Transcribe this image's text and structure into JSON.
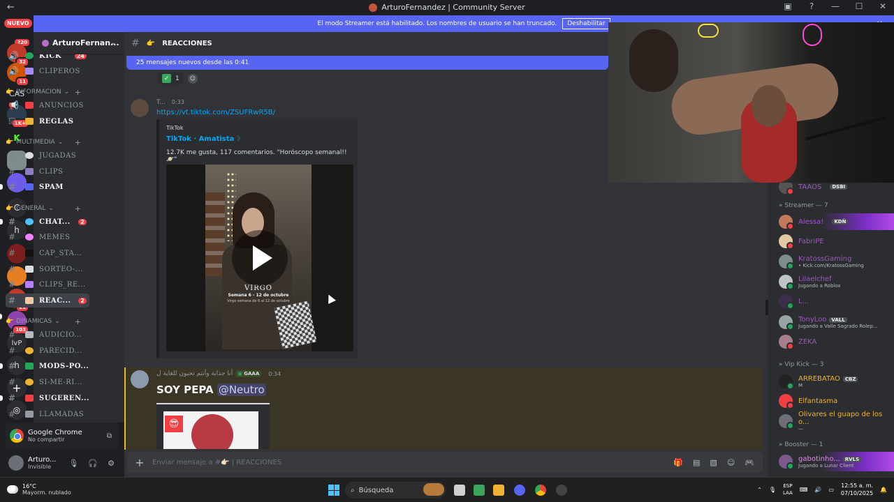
{
  "window": {
    "title": "ArturoFernandez | Community Server"
  },
  "streamer_bar": {
    "text": "El modo Streamer está habilitado. Los nombres de usuario se han truncado.",
    "button": "Deshabilitar"
  },
  "rail": {
    "nuevo": "NUEVO",
    "nuevo_count": "220",
    "servers": [
      {
        "label": "",
        "badge": "32"
      },
      {
        "label": "",
        "badge": "11"
      },
      {
        "label": "CAS",
        "badge": ""
      },
      {
        "label": "",
        "badge": "1K+"
      },
      {
        "label": "K",
        "badge": ""
      },
      {
        "label": "",
        "badge": ""
      },
      {
        "label": "",
        "badge": ""
      },
      {
        "label": "C",
        "badge": ""
      },
      {
        "label": "h",
        "badge": ""
      },
      {
        "label": "",
        "badge": ""
      },
      {
        "label": "",
        "badge": ""
      },
      {
        "label": "",
        "badge": "21"
      },
      {
        "label": "",
        "badge": "103"
      },
      {
        "label": "lvP",
        "badge": ""
      },
      {
        "label": "h",
        "badge": ""
      }
    ]
  },
  "server": {
    "name": "ArturoFernan...",
    "channels_top": [
      {
        "name": "KICK",
        "badge": "24"
      },
      {
        "name": "CLIPEROS",
        "badge": ""
      }
    ],
    "categories": [
      {
        "name": "INFORMACION",
        "channels": [
          {
            "name": "ANUNCIOS",
            "badge": ""
          },
          {
            "name": "REGLAS",
            "badge": ""
          }
        ]
      },
      {
        "name": "MULTIMEDIA",
        "channels": [
          {
            "name": "JUGADAS",
            "badge": ""
          },
          {
            "name": "CLIPS",
            "badge": ""
          },
          {
            "name": "SPAM",
            "badge": ""
          }
        ]
      },
      {
        "name": "GENERAL",
        "channels": [
          {
            "name": "CHAT...",
            "badge": "2"
          },
          {
            "name": "MEMES",
            "badge": ""
          },
          {
            "name": "CAP_STA...",
            "badge": ""
          },
          {
            "name": "SORTEO-...",
            "badge": ""
          },
          {
            "name": "CLIPS_RE...",
            "badge": ""
          },
          {
            "name": "REAC...",
            "badge": "2"
          }
        ]
      },
      {
        "name": "DINAMICAS",
        "channels": [
          {
            "name": "AUDICIO...",
            "badge": ""
          },
          {
            "name": "PARECID...",
            "badge": ""
          },
          {
            "name": "MODS-PO...",
            "badge": ""
          },
          {
            "name": "SI-ME-RI...",
            "badge": ""
          },
          {
            "name": "SUGEREN...",
            "badge": ""
          },
          {
            "name": "LLAMADAS",
            "badge": ""
          }
        ]
      }
    ]
  },
  "notification": {
    "app": "Google Chrome",
    "sub": "No compartir"
  },
  "user": {
    "name": "Arturo...",
    "status": "Invisible"
  },
  "channel": {
    "name": "REACCIONES"
  },
  "new_messages_bar": "25 mensajes nuevos desde las 0:41",
  "reaction": {
    "count": "1"
  },
  "message1": {
    "author": "T...",
    "time": "0:33",
    "link": "https://vt.tiktok.com/ZSUFRwR5B/",
    "embed": {
      "provider": "TikTok",
      "title": "TikTok · Amatista☽",
      "description": "12.7K me gusta, 117 comentarios. \"Horóscopo semanal!! 🪐\"",
      "video_title": "VIRGO",
      "video_sub": "Semana 6 - 12 de octubre",
      "video_sub2": "Virgo semana de 6 al 12 de octubre"
    }
  },
  "message2": {
    "author": "أنا جذابة وأنتم تحبون للغاية ل",
    "tag": "GAAA",
    "time": "0:34",
    "text": "SOY PEPA",
    "mention": "@Neutro"
  },
  "composer": {
    "placeholder": "Enviar mensaje a #👉🏻 | REACCIONES"
  },
  "members": {
    "top_partial": {
      "name": "TAAOS",
      "chip": "DSBI"
    },
    "sections": [
      {
        "title": "» Streamer — 7",
        "items": [
          {
            "name": "Alessa!",
            "chip": "KDÑ",
            "sub": "",
            "color": "#b04ae8"
          },
          {
            "name": "FabriPE",
            "chip": "",
            "sub": "",
            "color": "#9b59b6"
          },
          {
            "name": "KratossGaming",
            "chip": "",
            "sub": "• Kick.com/KratossGaming",
            "color": "#9b59b6"
          },
          {
            "name": "Lilaelchef",
            "chip": "",
            "sub": "Jugando a Roblox",
            "color": "#9b59b6"
          },
          {
            "name": "L...",
            "chip": "",
            "sub": "",
            "color": "#9b59b6"
          },
          {
            "name": "TonyLoo",
            "chip": "VALL",
            "sub": "Jugando a Valle Sagrado Rolep...",
            "color": "#9b59b6"
          },
          {
            "name": "ZEKA",
            "chip": "",
            "sub": "",
            "color": "#9b59b6"
          }
        ]
      },
      {
        "title": "» Vip Kick — 3",
        "items": [
          {
            "name": "ARREBATAO",
            "chip": "CBZ",
            "sub": "M",
            "color": "#f0b232"
          },
          {
            "name": "Elfantasma",
            "chip": "",
            "sub": "",
            "color": "#f0b232"
          },
          {
            "name": "Olivares el guapo de los o...",
            "chip": "",
            "sub": "—",
            "color": "#f0b232"
          }
        ]
      },
      {
        "title": "» Booster — 1",
        "items": [
          {
            "name": "gabotinho...",
            "chip": "RVLS",
            "sub": "Jugando a Lunar Client",
            "color": "#e08ee8"
          }
        ]
      }
    ]
  },
  "taskbar": {
    "weather_temp": "16°C",
    "weather_desc": "Mayorm. nublado",
    "search": "Búsqueda",
    "lang1": "ESP",
    "lang2": "LAA",
    "time": "12:55 a. m.",
    "date": "07/10/2025"
  },
  "colors": {
    "accent": "#5865f2",
    "mention_highlight": "#f0b232",
    "danger": "#f23f43"
  }
}
